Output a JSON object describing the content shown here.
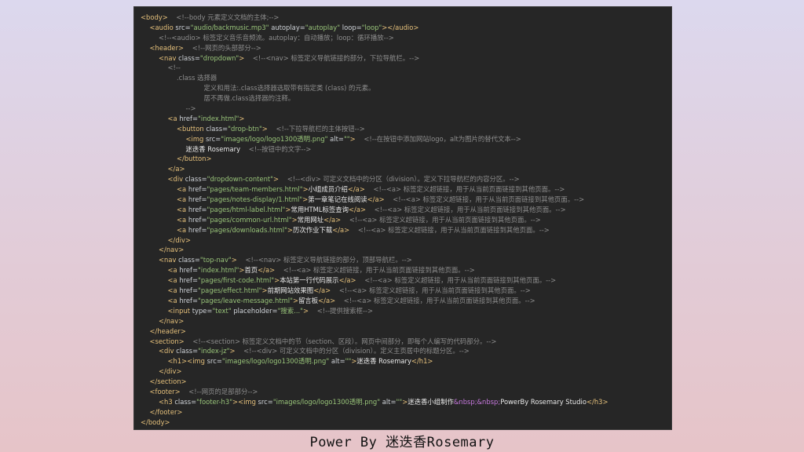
{
  "editor": {
    "lines": [
      {
        "indent": 0,
        "segs": [
          [
            "t",
            "<body>"
          ],
          [
            "c",
            "    <!--body 元素定义文档的主体;-->"
          ]
        ]
      },
      {
        "indent": 1,
        "segs": [
          [
            "t",
            "<audio"
          ],
          [
            "a",
            " src="
          ],
          [
            "s",
            "\"audio/backmusic.mp3\""
          ],
          [
            "a",
            " autoplay="
          ],
          [
            "s",
            "\"autoplay\""
          ],
          [
            "a",
            " loop="
          ],
          [
            "s",
            "\"loop\""
          ],
          [
            "t",
            "></audio>"
          ]
        ]
      },
      {
        "indent": 2,
        "segs": [
          [
            "c",
            "<!--<audio> 标签定义音乐音频流。autoplay：自动播放；loop：循环播放-->"
          ]
        ]
      },
      {
        "indent": 1,
        "segs": [
          [
            "t",
            "<header>"
          ],
          [
            "c",
            "    <!--网页的头部部分-->"
          ]
        ]
      },
      {
        "indent": 2,
        "segs": [
          [
            "t",
            "<nav"
          ],
          [
            "a",
            " class="
          ],
          [
            "s",
            "\"dropdown\""
          ],
          [
            "t",
            ">"
          ],
          [
            "c",
            "    <!--<nav> 标签定义导航链接的部分，下拉导航栏。-->"
          ]
        ]
      },
      {
        "indent": 3,
        "segs": [
          [
            "c",
            "<!--"
          ]
        ]
      },
      {
        "indent": 4,
        "segs": [
          [
            "c",
            ".class 选择器"
          ]
        ]
      },
      {
        "indent": 7,
        "segs": [
          [
            "c",
            "定义和用法:.class选择器选取带有指定类 (class) 的元素。"
          ]
        ]
      },
      {
        "indent": 7,
        "segs": [
          [
            "c",
            "居不再做.class选择器的注释。"
          ]
        ]
      },
      {
        "indent": 5,
        "segs": [
          [
            "c",
            "-->"
          ]
        ]
      },
      {
        "indent": 3,
        "segs": [
          [
            "t",
            "<a"
          ],
          [
            "a",
            " href="
          ],
          [
            "s",
            "\"index.html\""
          ],
          [
            "t",
            ">"
          ]
        ]
      },
      {
        "indent": 4,
        "segs": [
          [
            "t",
            "<button"
          ],
          [
            "a",
            " class="
          ],
          [
            "s",
            "\"drop-btn\""
          ],
          [
            "t",
            ">"
          ],
          [
            "c",
            "    <!--下拉导航栏的主体按钮-->"
          ]
        ]
      },
      {
        "indent": 5,
        "segs": [
          [
            "t",
            "<img"
          ],
          [
            "a",
            " src="
          ],
          [
            "s",
            "\"images/logo/logo1300透明.png\""
          ],
          [
            "a",
            " alt="
          ],
          [
            "s",
            "\"\""
          ],
          [
            "t",
            ">"
          ],
          [
            "c",
            "    <!--在按钮中添加网站logo，alt为图片的替代文本-->"
          ]
        ]
      },
      {
        "indent": 5,
        "segs": [
          [
            "p",
            "迷迭香 Rosemary"
          ],
          [
            "c",
            "    <!--按钮中的文字-->"
          ]
        ]
      },
      {
        "indent": 4,
        "segs": [
          [
            "t",
            "</button>"
          ]
        ]
      },
      {
        "indent": 3,
        "segs": [
          [
            "t",
            "</a>"
          ]
        ]
      },
      {
        "indent": 3,
        "segs": [
          [
            "t",
            "<div"
          ],
          [
            "a",
            " class="
          ],
          [
            "s",
            "\"dropdown-content\""
          ],
          [
            "t",
            ">"
          ],
          [
            "c",
            "    <!--<div> 可定义文档中的分区（division）。定义下拉导航栏的内容分区。-->"
          ]
        ]
      },
      {
        "indent": 4,
        "segs": [
          [
            "t",
            "<a"
          ],
          [
            "a",
            " href="
          ],
          [
            "s",
            "\"pages/team-members.html\""
          ],
          [
            "t",
            ">"
          ],
          [
            "p",
            "小组成员介绍"
          ],
          [
            "t",
            "</a>"
          ],
          [
            "c",
            "    <!--<a> 标签定义超链接，用于从当前页面链接到其他页面。-->"
          ]
        ]
      },
      {
        "indent": 4,
        "segs": [
          [
            "t",
            "<a"
          ],
          [
            "a",
            " href="
          ],
          [
            "s",
            "\"pages/notes-display/1.html\""
          ],
          [
            "t",
            ">"
          ],
          [
            "p",
            "第一章笔记在线阅读"
          ],
          [
            "t",
            "</a>"
          ],
          [
            "c",
            "    <!--<a> 标签定义超链接，用于从当前页面链接到其他页面。-->"
          ]
        ]
      },
      {
        "indent": 4,
        "segs": [
          [
            "t",
            "<a"
          ],
          [
            "a",
            " href="
          ],
          [
            "s",
            "\"pages/html-label.html\""
          ],
          [
            "t",
            ">"
          ],
          [
            "p",
            "常用HTML标签查询"
          ],
          [
            "t",
            "</a>"
          ],
          [
            "c",
            "    <!--<a> 标签定义超链接，用于从当前页面链接到其他页面。-->"
          ]
        ]
      },
      {
        "indent": 4,
        "segs": [
          [
            "t",
            "<a"
          ],
          [
            "a",
            " href="
          ],
          [
            "s",
            "\"pages/common-url.html\""
          ],
          [
            "t",
            ">"
          ],
          [
            "p",
            "常用网址"
          ],
          [
            "t",
            "</a>"
          ],
          [
            "c",
            "    <!--<a> 标签定义超链接，用于从当前页面链接到其他页面。-->"
          ]
        ]
      },
      {
        "indent": 4,
        "segs": [
          [
            "t",
            "<a"
          ],
          [
            "a",
            " href="
          ],
          [
            "s",
            "\"pages/downloads.html\""
          ],
          [
            "t",
            ">"
          ],
          [
            "p",
            "历次作业下载"
          ],
          [
            "t",
            "</a>"
          ],
          [
            "c",
            "    <!--<a> 标签定义超链接，用于从当前页面链接到其他页面。-->"
          ]
        ]
      },
      {
        "indent": 3,
        "segs": [
          [
            "t",
            "</div>"
          ]
        ]
      },
      {
        "indent": 2,
        "segs": [
          [
            "t",
            "</nav>"
          ]
        ]
      },
      {
        "indent": 2,
        "segs": [
          [
            "t",
            "<nav"
          ],
          [
            "a",
            " class="
          ],
          [
            "s",
            "\"top-nav\""
          ],
          [
            "t",
            ">"
          ],
          [
            "c",
            "    <!--<nav> 标签定义导航链接的部分，顶部导航栏。-->"
          ]
        ]
      },
      {
        "indent": 3,
        "segs": [
          [
            "t",
            "<a"
          ],
          [
            "a",
            " href="
          ],
          [
            "s",
            "\"index.html\""
          ],
          [
            "t",
            ">"
          ],
          [
            "p",
            "首页"
          ],
          [
            "t",
            "</a>"
          ],
          [
            "c",
            "    <!--<a> 标签定义超链接，用于从当前页面链接到其他页面。-->"
          ]
        ]
      },
      {
        "indent": 3,
        "segs": [
          [
            "t",
            "<a"
          ],
          [
            "a",
            " href="
          ],
          [
            "s",
            "\"pages/first-code.html\""
          ],
          [
            "t",
            ">"
          ],
          [
            "p",
            "本站第一行代码展示"
          ],
          [
            "t",
            "</a>"
          ],
          [
            "c",
            "    <!--<a> 标签定义超链接，用于从当前页面链接到其他页面。-->"
          ]
        ]
      },
      {
        "indent": 3,
        "segs": [
          [
            "t",
            "<a"
          ],
          [
            "a",
            " href="
          ],
          [
            "s",
            "\"pages/effect.html\""
          ],
          [
            "t",
            ">"
          ],
          [
            "p",
            "前期网站效果图"
          ],
          [
            "t",
            "</a>"
          ],
          [
            "c",
            "    <!--<a> 标签定义超链接，用于从当前页面链接到其他页面。-->"
          ]
        ]
      },
      {
        "indent": 3,
        "segs": [
          [
            "t",
            "<a"
          ],
          [
            "a",
            " href="
          ],
          [
            "s",
            "\"pages/leave-message.html\""
          ],
          [
            "t",
            ">"
          ],
          [
            "p",
            "留言板"
          ],
          [
            "t",
            "</a>"
          ],
          [
            "c",
            "    <!--<a> 标签定义超链接，用于从当前页面链接到其他页面。-->"
          ]
        ]
      },
      {
        "indent": 3,
        "segs": [
          [
            "t",
            "<input"
          ],
          [
            "a",
            " type="
          ],
          [
            "s",
            "\"text\""
          ],
          [
            "a",
            " placeholder="
          ],
          [
            "s",
            "\"搜索...\""
          ],
          [
            "t",
            ">"
          ],
          [
            "c",
            "    <!--提供搜索框-->"
          ]
        ]
      },
      {
        "indent": 2,
        "segs": [
          [
            "t",
            "</nav>"
          ]
        ]
      },
      {
        "indent": 1,
        "segs": [
          [
            "t",
            "</header>"
          ]
        ]
      },
      {
        "indent": 1,
        "segs": [
          [
            "t",
            "<section>"
          ],
          [
            "c",
            "    <!--<section> 标签定义文档中的节（section、区段）。网页中间部分，即每个人编写的代码部分。-->"
          ]
        ]
      },
      {
        "indent": 2,
        "segs": [
          [
            "t",
            "<div"
          ],
          [
            "a",
            " class="
          ],
          [
            "s",
            "\"index-jz\""
          ],
          [
            "t",
            ">"
          ],
          [
            "c",
            "    <!--<div> 可定义文档中的分区（division）。定义主页居中的标题分区。-->"
          ]
        ]
      },
      {
        "indent": 3,
        "segs": [
          [
            "t",
            "<h1><img"
          ],
          [
            "a",
            " src="
          ],
          [
            "s",
            "\"images/logo/logo1300透明.png\""
          ],
          [
            "a",
            " alt="
          ],
          [
            "s",
            "\"\""
          ],
          [
            "t",
            ">"
          ],
          [
            "p",
            "迷迭香 Rosemary"
          ],
          [
            "t",
            "</h1>"
          ]
        ]
      },
      {
        "indent": 2,
        "segs": [
          [
            "t",
            "</div>"
          ]
        ]
      },
      {
        "indent": 1,
        "segs": [
          [
            "t",
            "</section>"
          ]
        ]
      },
      {
        "indent": 1,
        "segs": [
          [
            "t",
            "<footer>"
          ],
          [
            "c",
            "    <!--网页的足部部分-->"
          ]
        ]
      },
      {
        "indent": 2,
        "segs": [
          [
            "t",
            "<h3"
          ],
          [
            "a",
            " class="
          ],
          [
            "s",
            "\"footer-h3\""
          ],
          [
            "t",
            "><img"
          ],
          [
            "a",
            " src="
          ],
          [
            "s",
            "\"images/logo/logo1300透明.png\""
          ],
          [
            "a",
            " alt="
          ],
          [
            "s",
            "\"\""
          ],
          [
            "t",
            ">"
          ],
          [
            "p",
            "迷迭香小组制作"
          ],
          [
            "e",
            "&nbsp;&nbsp;"
          ],
          [
            "p",
            "PowerBy Rosemary Studio"
          ],
          [
            "t",
            "</h3>"
          ]
        ]
      },
      {
        "indent": 1,
        "segs": [
          [
            "t",
            "</footer>"
          ]
        ]
      },
      {
        "indent": 0,
        "segs": [
          [
            "t",
            "</body>"
          ]
        ]
      }
    ]
  },
  "caption": "Power By 迷迭香Rosemary"
}
